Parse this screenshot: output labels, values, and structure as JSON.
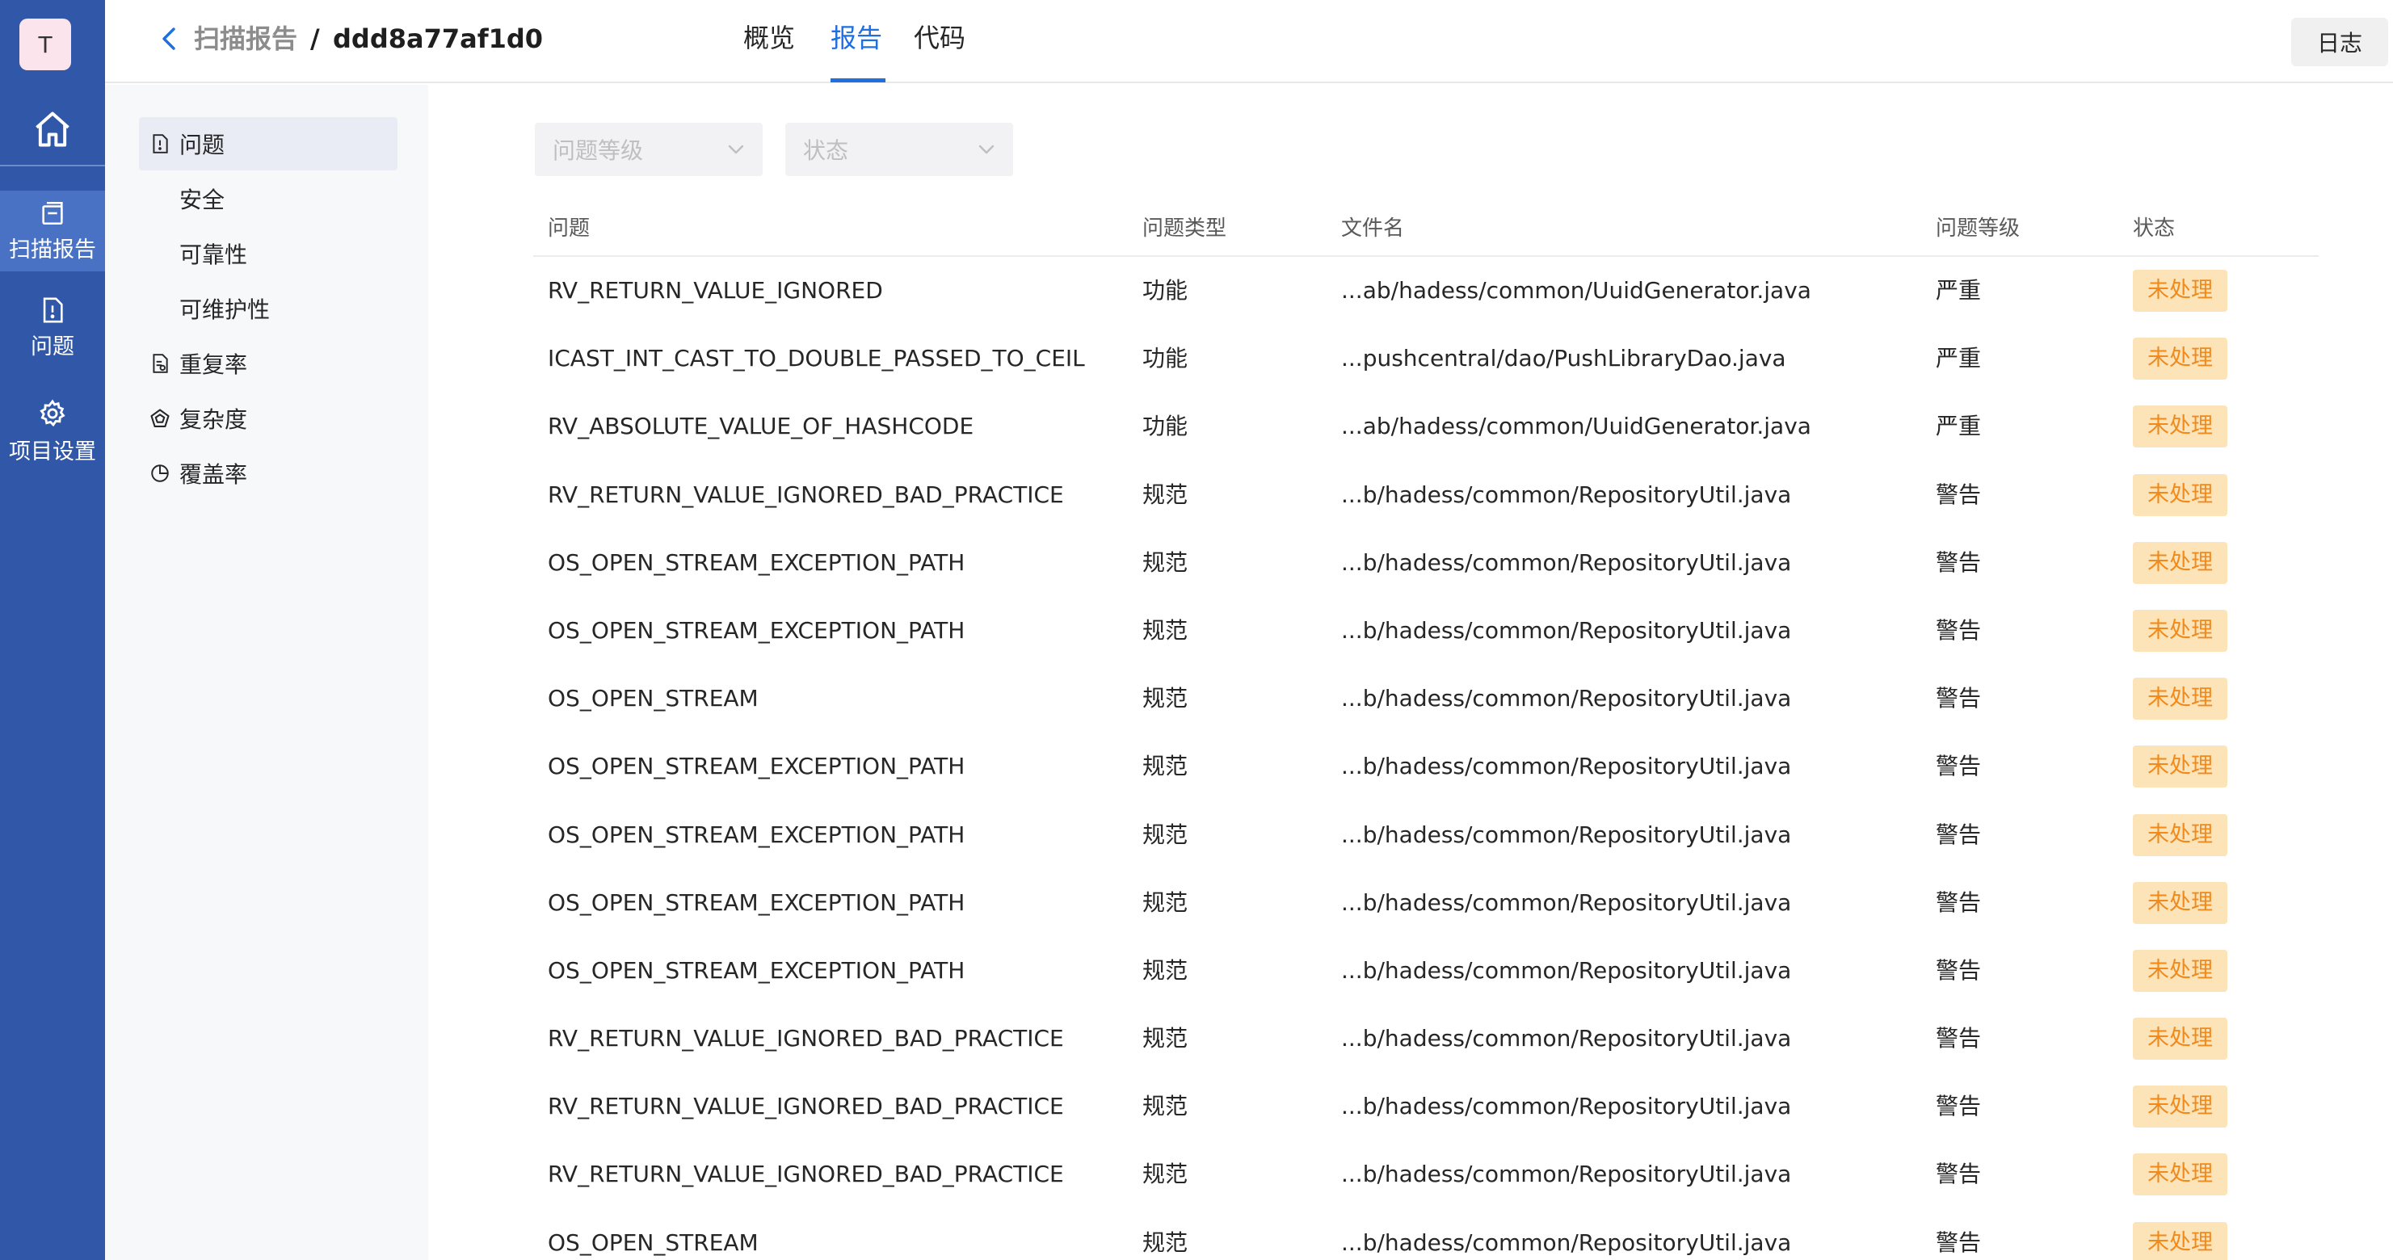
{
  "rail": {
    "avatar": "T",
    "items": [
      {
        "label": "扫描报告"
      },
      {
        "label": "问题"
      },
      {
        "label": "项目设置"
      }
    ]
  },
  "header": {
    "breadcrumb_parent": "扫描报告",
    "breadcrumb_sep": "/",
    "breadcrumb_current": "ddd8a77af1d0",
    "tabs": [
      "概览",
      "报告",
      "代码"
    ],
    "active_tab": "报告",
    "log_button": "日志"
  },
  "subnav": {
    "items": [
      "问题",
      "安全",
      "可靠性",
      "可维护性",
      "重复率",
      "复杂度",
      "覆盖率"
    ]
  },
  "filters": {
    "level_placeholder": "问题等级",
    "status_placeholder": "状态"
  },
  "table": {
    "headers": [
      "问题",
      "问题类型",
      "文件名",
      "问题等级",
      "状态"
    ],
    "rows": [
      [
        "RV_RETURN_VALUE_IGNORED",
        "功能",
        "...ab/hadess/common/UuidGenerator.java",
        "严重",
        "未处理"
      ],
      [
        "ICAST_INT_CAST_TO_DOUBLE_PASSED_TO_CEIL",
        "功能",
        "...pushcentral/dao/PushLibraryDao.java",
        "严重",
        "未处理"
      ],
      [
        "RV_ABSOLUTE_VALUE_OF_HASHCODE",
        "功能",
        "...ab/hadess/common/UuidGenerator.java",
        "严重",
        "未处理"
      ],
      [
        "RV_RETURN_VALUE_IGNORED_BAD_PRACTICE",
        "规范",
        "...b/hadess/common/RepositoryUtil.java",
        "警告",
        "未处理"
      ],
      [
        "OS_OPEN_STREAM_EXCEPTION_PATH",
        "规范",
        "...b/hadess/common/RepositoryUtil.java",
        "警告",
        "未处理"
      ],
      [
        "OS_OPEN_STREAM_EXCEPTION_PATH",
        "规范",
        "...b/hadess/common/RepositoryUtil.java",
        "警告",
        "未处理"
      ],
      [
        "OS_OPEN_STREAM",
        "规范",
        "...b/hadess/common/RepositoryUtil.java",
        "警告",
        "未处理"
      ],
      [
        "OS_OPEN_STREAM_EXCEPTION_PATH",
        "规范",
        "...b/hadess/common/RepositoryUtil.java",
        "警告",
        "未处理"
      ],
      [
        "OS_OPEN_STREAM_EXCEPTION_PATH",
        "规范",
        "...b/hadess/common/RepositoryUtil.java",
        "警告",
        "未处理"
      ],
      [
        "OS_OPEN_STREAM_EXCEPTION_PATH",
        "规范",
        "...b/hadess/common/RepositoryUtil.java",
        "警告",
        "未处理"
      ],
      [
        "OS_OPEN_STREAM_EXCEPTION_PATH",
        "规范",
        "...b/hadess/common/RepositoryUtil.java",
        "警告",
        "未处理"
      ],
      [
        "RV_RETURN_VALUE_IGNORED_BAD_PRACTICE",
        "规范",
        "...b/hadess/common/RepositoryUtil.java",
        "警告",
        "未处理"
      ],
      [
        "RV_RETURN_VALUE_IGNORED_BAD_PRACTICE",
        "规范",
        "...b/hadess/common/RepositoryUtil.java",
        "警告",
        "未处理"
      ],
      [
        "RV_RETURN_VALUE_IGNORED_BAD_PRACTICE",
        "规范",
        "...b/hadess/common/RepositoryUtil.java",
        "警告",
        "未处理"
      ],
      [
        "OS_OPEN_STREAM",
        "规范",
        "...b/hadess/common/RepositoryUtil.java",
        "警告",
        "未处理"
      ]
    ]
  },
  "colors": {
    "rail": "#3158a8",
    "accent": "#1f6fe0",
    "badge_bg": "#fde3b8",
    "badge_text": "#f08a1c"
  }
}
